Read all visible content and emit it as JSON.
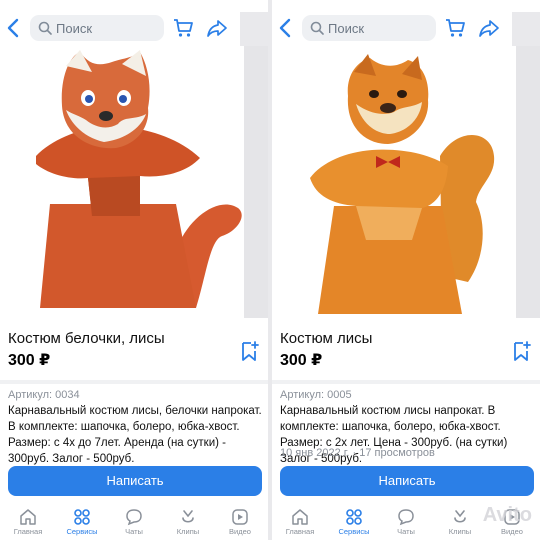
{
  "colors": {
    "accent": "#2b7fe7",
    "muted": "#8a9099"
  },
  "search": {
    "placeholder": "Поиск"
  },
  "listings": [
    {
      "title": "Костюм белочки, лисы",
      "price": "300 ₽",
      "article": "Артикул: 0034",
      "description": "Карнавальный костюм лисы, белочки напрокат. В комплекте: шапочка, болеро, юбка-хвост. Размер: с 4х до 7лет. Аренда (на сутки) - 300руб. Залог - 500руб.",
      "meta": "",
      "cta": "Написать"
    },
    {
      "title": "Костюм лисы",
      "price": "300 ₽",
      "article": "Артикул: 0005",
      "description": "Карнавальный костюм лисы напрокат. В комплекте: шапочка, болеро, юбка-хвост. Размер: с 2х лет. Цена - 300руб. (на сутки) Залог - 500руб.",
      "meta": "10 янв 2022 г. · 17 просмотров",
      "cta": "Написать"
    }
  ],
  "tabs": [
    {
      "label": "Главная",
      "icon": "home-icon"
    },
    {
      "label": "Сервисы",
      "icon": "services-icon",
      "active": true
    },
    {
      "label": "Чаты",
      "icon": "chat-icon"
    },
    {
      "label": "Клипы",
      "icon": "clips-icon"
    },
    {
      "label": "Видео",
      "icon": "video-icon"
    }
  ],
  "watermark": "Avito"
}
